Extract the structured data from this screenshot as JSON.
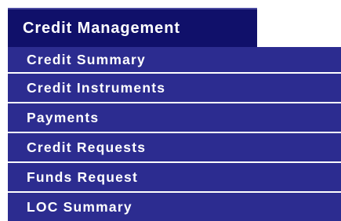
{
  "nav": {
    "title": "Credit Management",
    "items": [
      {
        "label": "Credit Summary"
      },
      {
        "label": "Credit Instruments"
      },
      {
        "label": "Payments"
      },
      {
        "label": "Credit Requests"
      },
      {
        "label": "Funds Request"
      },
      {
        "label": "LOC Summary"
      }
    ]
  },
  "colors": {
    "tab_background": "#10106a",
    "item_background": "#2c2c90",
    "text": "#ffffff"
  }
}
